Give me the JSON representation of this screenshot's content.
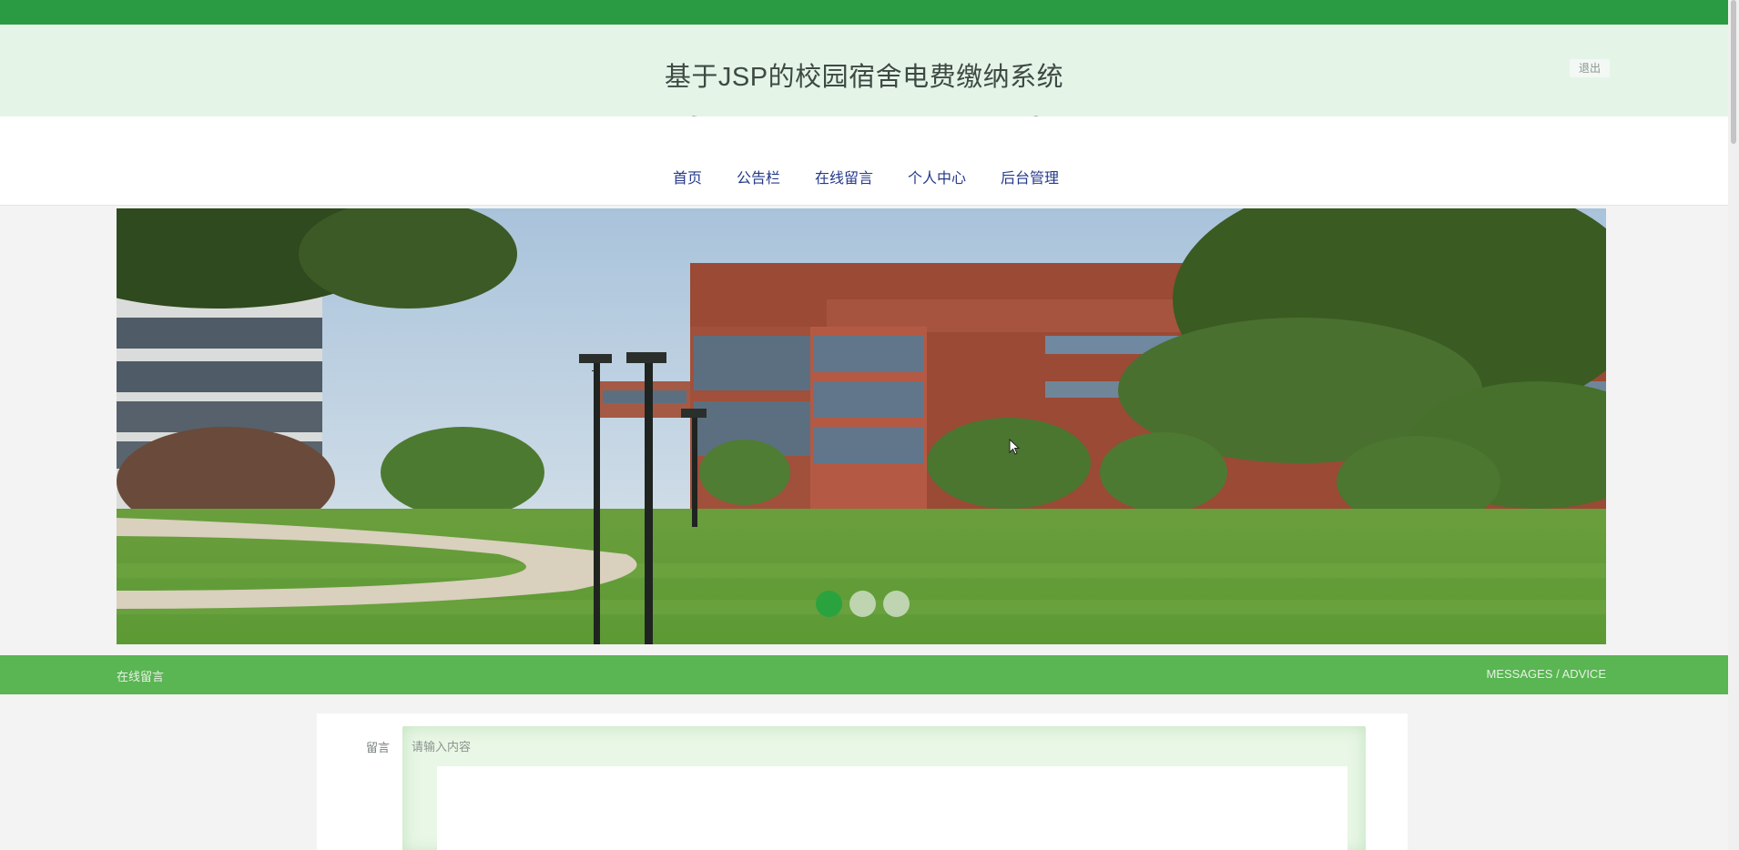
{
  "header": {
    "title": "基于JSP的校园宿舍电费缴纳系统",
    "logout_label": "退出"
  },
  "nav": {
    "items": [
      {
        "label": "首页",
        "active": false
      },
      {
        "label": "公告栏",
        "active": false
      },
      {
        "label": "在线留言",
        "active": true
      },
      {
        "label": "个人中心",
        "active": false
      },
      {
        "label": "后台管理",
        "active": false
      }
    ]
  },
  "banner": {
    "slide_count": 3,
    "active_slide": 1
  },
  "section": {
    "title_cn": "在线留言",
    "title_en": "MESSAGES / ADVICE"
  },
  "form": {
    "message_label": "留言",
    "message_placeholder": "请输入内容",
    "message_value": ""
  },
  "colors": {
    "brand_green": "#2a9a43",
    "section_bar": "#5ab553",
    "header_bg": "#e4f5e8",
    "nav_text": "#253a8a"
  }
}
